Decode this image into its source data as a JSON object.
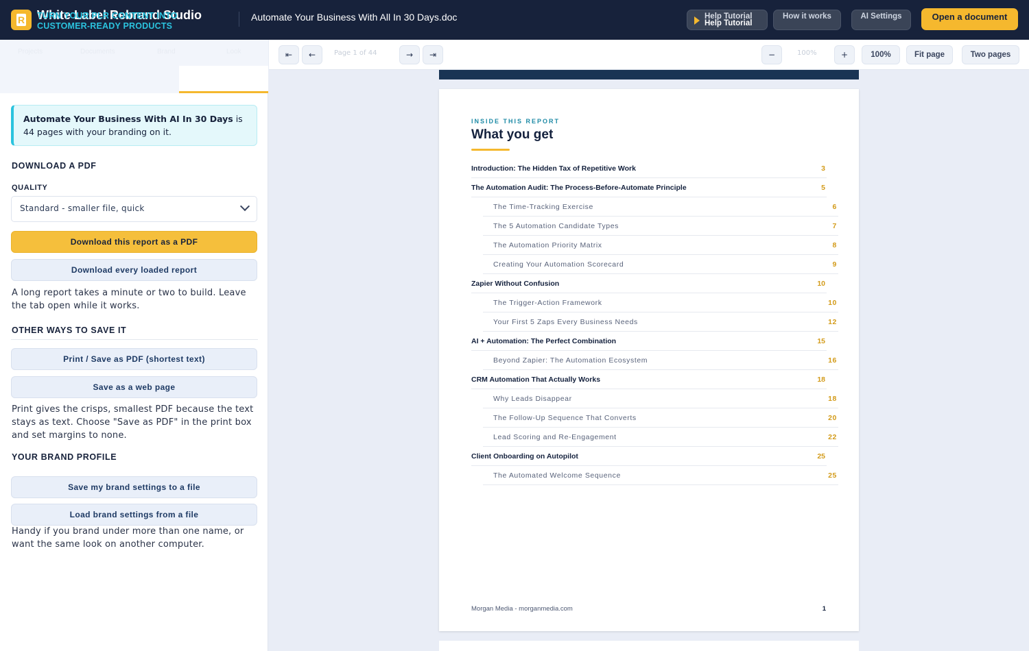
{
  "header": {
    "brand_title": "White Label Rebrand Studio",
    "brand_tagline": "TURN YOUR PLR CONTENT INTO CUSTOMER-READY PRODUCTS",
    "document_title": "Automate Your Business With All In 30 Days.doc",
    "help_label_top": "Help Tutorial",
    "help_label_bottom": "Help Tutorial",
    "how_label": "How it works",
    "ai_label": "AI Settings",
    "open_label": "Open a document"
  },
  "sidebar": {
    "tabs": [
      "Projects",
      "Documents",
      "Brand",
      "Look"
    ],
    "info_title": "Automate Your Business With AI In 30 Days",
    "info_tail": " is",
    "info_line2": "44 pages with your branding on it.",
    "download_heading": "DOWNLOAD A PDF",
    "quality_label": "QUALITY",
    "quality_value": "Standard - smaller file, quick",
    "download_btn": "Download this report as a PDF",
    "download_all_btn": "Download every loaded report",
    "download_note": "A long report takes a minute or two to build. Leave the tab open while it works.",
    "other_heading": "OTHER WAYS TO SAVE IT",
    "print_btn": "Print / Save as PDF (shortest text)",
    "web_btn": "Save as a web page",
    "print_note": "Print gives the crisps, smallest PDF because the text stays as text. Choose \"Save as PDF\" in the print box and set margins to none.",
    "brand_heading": "YOUR BRAND PROFILE",
    "save_brand_btn": "Save my brand settings to a file",
    "load_brand_btn": "Load brand settings from a file",
    "brand_note": "Handy if you brand under more than one name, or want the same look on another computer."
  },
  "toolbar": {
    "first": "⇤",
    "prev": "←",
    "page_info": "Page 1 of 44",
    "next": "→",
    "last": "⇥",
    "zoom_out": "−",
    "zoom_ghost": "100%",
    "zoom_in": "+",
    "zoom_level": "100%",
    "fit_page": "Fit page",
    "two_pages": "Two pages"
  },
  "document": {
    "eyebrow": "INSIDE THIS REPORT",
    "title": "What you get",
    "toc": [
      {
        "title": "Introduction: The Hidden Tax of Repetitive Work",
        "page": "3",
        "level": "main"
      },
      {
        "title": "The Automation Audit: The Process-Before-Automate Principle",
        "page": "5",
        "level": "main"
      },
      {
        "title": "The Time-Tracking Exercise",
        "page": "6",
        "level": "sub"
      },
      {
        "title": "The 5 Automation Candidate Types",
        "page": "7",
        "level": "sub"
      },
      {
        "title": "The Automation Priority Matrix",
        "page": "8",
        "level": "sub"
      },
      {
        "title": "Creating Your Automation Scorecard",
        "page": "9",
        "level": "sub"
      },
      {
        "title": "Zapier Without Confusion",
        "page": "10",
        "level": "main"
      },
      {
        "title": "The Trigger-Action Framework",
        "page": "10",
        "level": "sub"
      },
      {
        "title": "Your First 5 Zaps Every Business Needs",
        "page": "12",
        "level": "sub"
      },
      {
        "title": "AI + Automation: The Perfect Combination",
        "page": "15",
        "level": "main"
      },
      {
        "title": "Beyond Zapier: The Automation Ecosystem",
        "page": "16",
        "level": "sub"
      },
      {
        "title": "CRM Automation That Actually Works",
        "page": "18",
        "level": "main"
      },
      {
        "title": "Why Leads Disappear",
        "page": "18",
        "level": "sub"
      },
      {
        "title": "The Follow-Up Sequence That Converts",
        "page": "20",
        "level": "sub"
      },
      {
        "title": "Lead Scoring and Re-Engagement",
        "page": "22",
        "level": "sub"
      },
      {
        "title": "Client Onboarding on Autopilot",
        "page": "25",
        "level": "main"
      },
      {
        "title": "The Automated Welcome Sequence",
        "page": "25",
        "level": "sub"
      }
    ],
    "footer_left": "Morgan Media - morganmedia.com",
    "footer_right": "1"
  }
}
